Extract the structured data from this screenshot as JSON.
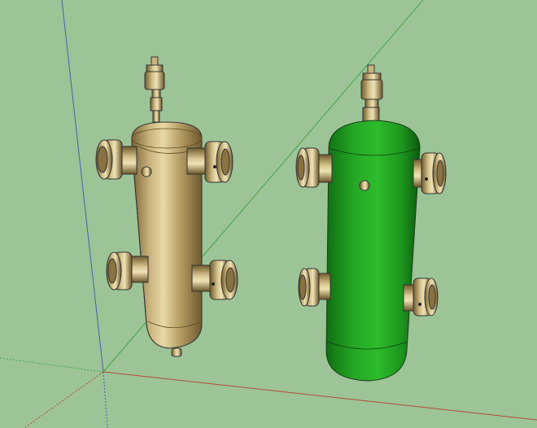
{
  "scene": {
    "background_color": "#9dc497",
    "axes": {
      "red_axis_color": "#b04a3a",
      "green_axis_color": "#3fa84a",
      "blue_axis_color": "#4a5fb0"
    },
    "objects": [
      {
        "name": "hydraulic-separator-brass",
        "material": "brass",
        "color": "#b9a06a"
      },
      {
        "name": "hydraulic-separator-green",
        "material": "painted-green",
        "color": "#22a022"
      }
    ]
  }
}
